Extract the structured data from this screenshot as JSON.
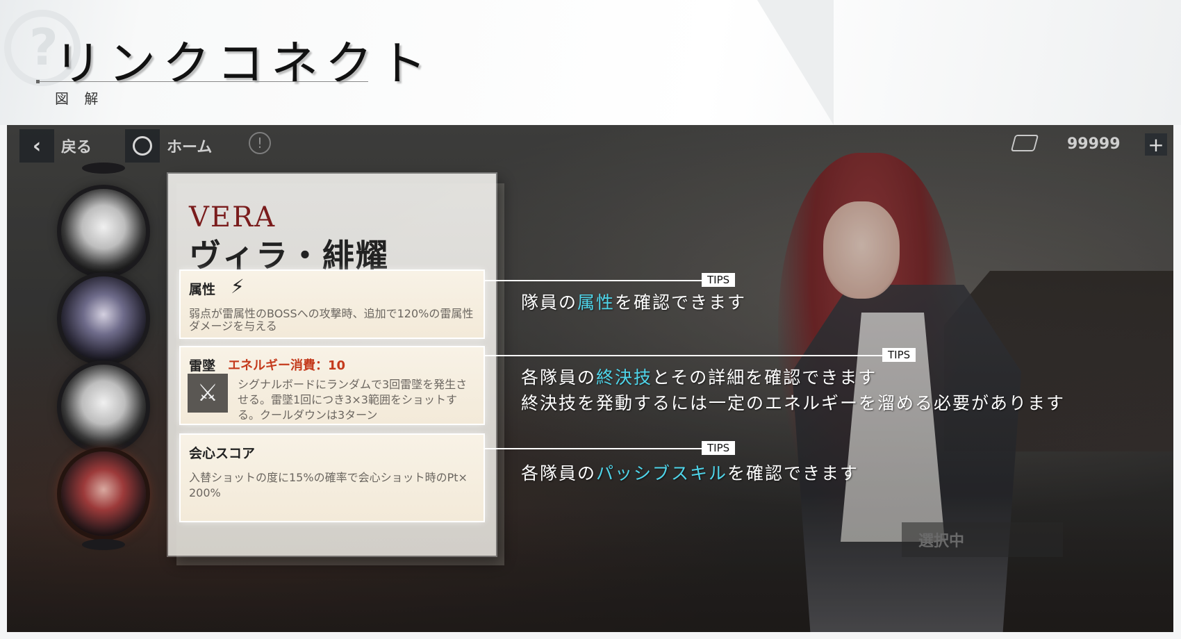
{
  "header": {
    "title": "リンクコネクト",
    "subtitle": "図 解",
    "deco_glyph": "?"
  },
  "topbar": {
    "back_label": "戻る",
    "home_label": "ホーム",
    "currency_value": "99999"
  },
  "character": {
    "name_en": "VERA",
    "name_jp": "ヴィラ・緋耀"
  },
  "boxes": {
    "attribute": {
      "title": "属性",
      "text_line1": "弱点が雷属性のBOSSへの攻撃時、追加で120%の雷属性",
      "text_line2": "ダメージを与える"
    },
    "ultimate": {
      "title": "雷墜",
      "energy": "エネルギー消費：10",
      "text_line1": "シグナルボードにランダムで3回雷墜を発生さ",
      "text_line2": "せる。雷墜1回につき3×3範囲をショットす",
      "text_line3": "る。クールダウンは3ターン"
    },
    "passive": {
      "title": "会心スコア",
      "text_line1": "入替ショットの度に15%の確率で会心ショット時のPt×",
      "text_line2": "200%"
    }
  },
  "tips": {
    "tag": "TIPS",
    "tip1": {
      "pre": "隊員の",
      "highlight": "属性",
      "post": "を確認できます"
    },
    "tip2": {
      "pre": "各隊員の",
      "highlight": "終決技",
      "post": "とその詳細を確認できます",
      "line2": "終決技を発動するには一定のエネルギーを溜める必要があります"
    },
    "tip3": {
      "pre": "各隊員の",
      "highlight": "パッシブスキル",
      "post": "を確認できます"
    }
  },
  "select_button": "選択中",
  "colors": {
    "highlight": "#4fd5ea",
    "energy": "#c43a1c",
    "name_en": "#7a1c1c"
  }
}
